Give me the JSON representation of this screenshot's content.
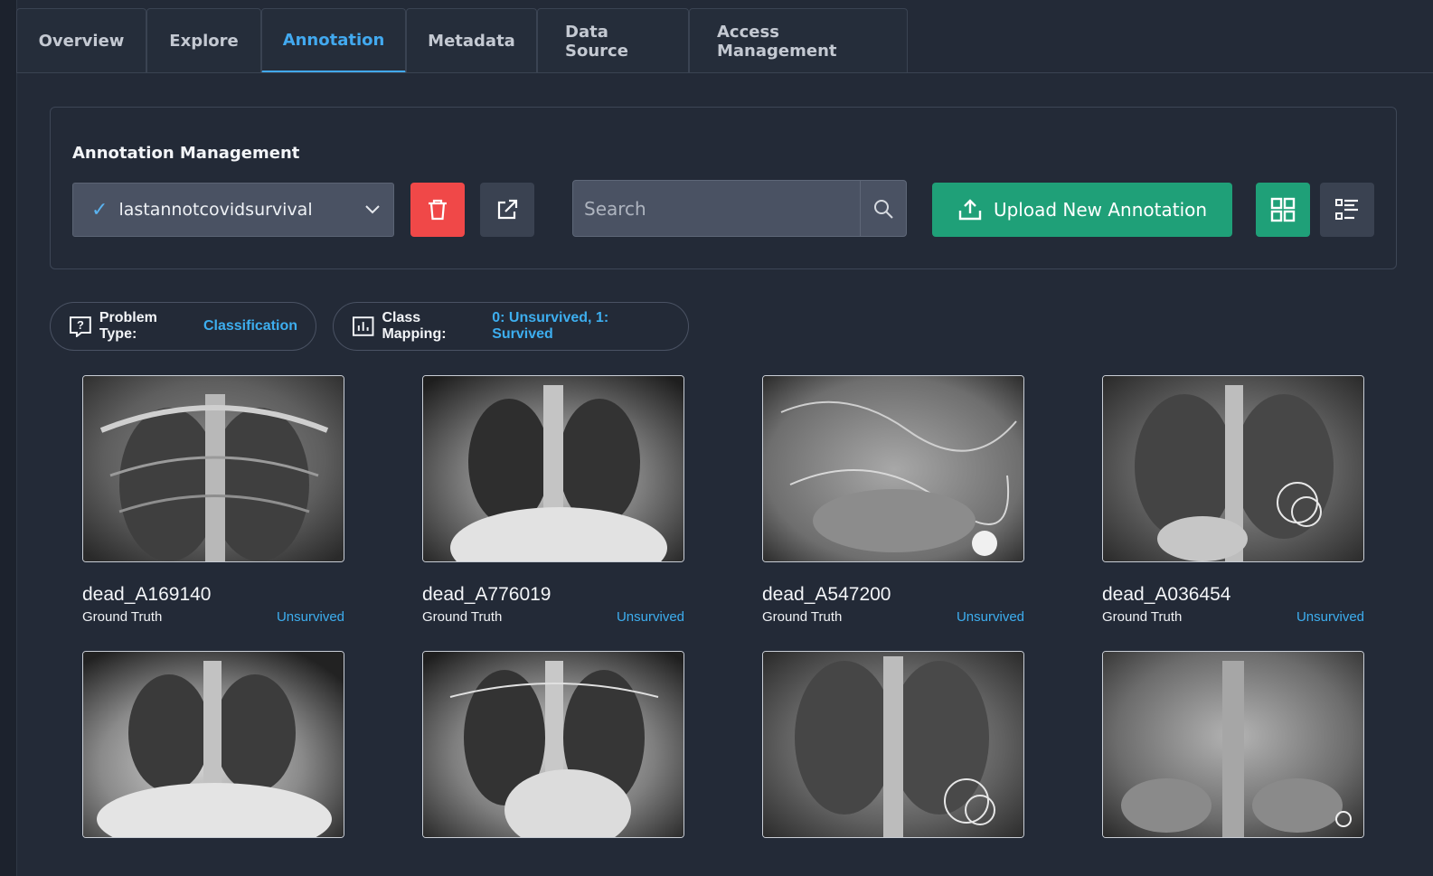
{
  "tabs": [
    {
      "label": "Overview",
      "active": false
    },
    {
      "label": "Explore",
      "active": false
    },
    {
      "label": "Annotation",
      "active": true
    },
    {
      "label": "Metadata",
      "active": false
    },
    {
      "label": "Data Source",
      "active": false
    },
    {
      "label": "Access Management",
      "active": false
    }
  ],
  "annotation_management": {
    "title": "Annotation Management",
    "selected_annotation": "lastannotcovidsurvival",
    "search_placeholder": "Search",
    "search_value": "",
    "upload_label": "Upload New Annotation"
  },
  "info": {
    "problem_type_label": "Problem Type:",
    "problem_type_value": "Classification",
    "class_mapping_label": "Class Mapping:",
    "class_mapping_value": "0: Unsurvived, 1: Survived"
  },
  "cards": [
    {
      "name": "dead_A169140",
      "label_key": "Ground Truth",
      "label_value": "Unsurvived"
    },
    {
      "name": "dead_A776019",
      "label_key": "Ground Truth",
      "label_value": "Unsurvived"
    },
    {
      "name": "dead_A547200",
      "label_key": "Ground Truth",
      "label_value": "Unsurvived"
    },
    {
      "name": "dead_A036454",
      "label_key": "Ground Truth",
      "label_value": "Unsurvived"
    },
    {
      "name": "",
      "label_key": "",
      "label_value": ""
    },
    {
      "name": "",
      "label_key": "",
      "label_value": ""
    },
    {
      "name": "",
      "label_key": "",
      "label_value": ""
    },
    {
      "name": "",
      "label_key": "",
      "label_value": ""
    }
  ],
  "colors": {
    "accent": "#42a9ef",
    "delete": "#f04848",
    "upload": "#1fa078",
    "background": "#232a37"
  }
}
